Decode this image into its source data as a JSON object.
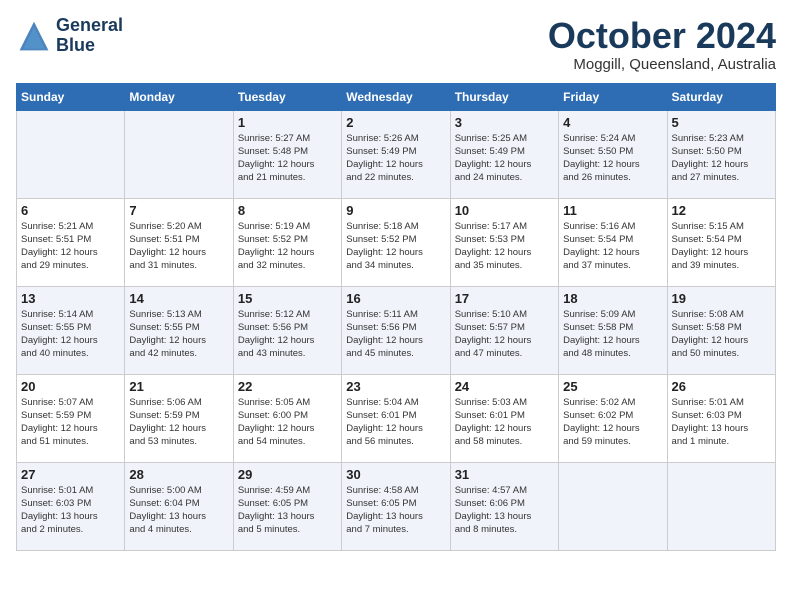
{
  "header": {
    "logo_line1": "General",
    "logo_line2": "Blue",
    "month": "October 2024",
    "location": "Moggill, Queensland, Australia"
  },
  "days_of_week": [
    "Sunday",
    "Monday",
    "Tuesday",
    "Wednesday",
    "Thursday",
    "Friday",
    "Saturday"
  ],
  "weeks": [
    [
      {
        "day": "",
        "info": ""
      },
      {
        "day": "",
        "info": ""
      },
      {
        "day": "1",
        "info": "Sunrise: 5:27 AM\nSunset: 5:48 PM\nDaylight: 12 hours\nand 21 minutes."
      },
      {
        "day": "2",
        "info": "Sunrise: 5:26 AM\nSunset: 5:49 PM\nDaylight: 12 hours\nand 22 minutes."
      },
      {
        "day": "3",
        "info": "Sunrise: 5:25 AM\nSunset: 5:49 PM\nDaylight: 12 hours\nand 24 minutes."
      },
      {
        "day": "4",
        "info": "Sunrise: 5:24 AM\nSunset: 5:50 PM\nDaylight: 12 hours\nand 26 minutes."
      },
      {
        "day": "5",
        "info": "Sunrise: 5:23 AM\nSunset: 5:50 PM\nDaylight: 12 hours\nand 27 minutes."
      }
    ],
    [
      {
        "day": "6",
        "info": "Sunrise: 5:21 AM\nSunset: 5:51 PM\nDaylight: 12 hours\nand 29 minutes."
      },
      {
        "day": "7",
        "info": "Sunrise: 5:20 AM\nSunset: 5:51 PM\nDaylight: 12 hours\nand 31 minutes."
      },
      {
        "day": "8",
        "info": "Sunrise: 5:19 AM\nSunset: 5:52 PM\nDaylight: 12 hours\nand 32 minutes."
      },
      {
        "day": "9",
        "info": "Sunrise: 5:18 AM\nSunset: 5:52 PM\nDaylight: 12 hours\nand 34 minutes."
      },
      {
        "day": "10",
        "info": "Sunrise: 5:17 AM\nSunset: 5:53 PM\nDaylight: 12 hours\nand 35 minutes."
      },
      {
        "day": "11",
        "info": "Sunrise: 5:16 AM\nSunset: 5:54 PM\nDaylight: 12 hours\nand 37 minutes."
      },
      {
        "day": "12",
        "info": "Sunrise: 5:15 AM\nSunset: 5:54 PM\nDaylight: 12 hours\nand 39 minutes."
      }
    ],
    [
      {
        "day": "13",
        "info": "Sunrise: 5:14 AM\nSunset: 5:55 PM\nDaylight: 12 hours\nand 40 minutes."
      },
      {
        "day": "14",
        "info": "Sunrise: 5:13 AM\nSunset: 5:55 PM\nDaylight: 12 hours\nand 42 minutes."
      },
      {
        "day": "15",
        "info": "Sunrise: 5:12 AM\nSunset: 5:56 PM\nDaylight: 12 hours\nand 43 minutes."
      },
      {
        "day": "16",
        "info": "Sunrise: 5:11 AM\nSunset: 5:56 PM\nDaylight: 12 hours\nand 45 minutes."
      },
      {
        "day": "17",
        "info": "Sunrise: 5:10 AM\nSunset: 5:57 PM\nDaylight: 12 hours\nand 47 minutes."
      },
      {
        "day": "18",
        "info": "Sunrise: 5:09 AM\nSunset: 5:58 PM\nDaylight: 12 hours\nand 48 minutes."
      },
      {
        "day": "19",
        "info": "Sunrise: 5:08 AM\nSunset: 5:58 PM\nDaylight: 12 hours\nand 50 minutes."
      }
    ],
    [
      {
        "day": "20",
        "info": "Sunrise: 5:07 AM\nSunset: 5:59 PM\nDaylight: 12 hours\nand 51 minutes."
      },
      {
        "day": "21",
        "info": "Sunrise: 5:06 AM\nSunset: 5:59 PM\nDaylight: 12 hours\nand 53 minutes."
      },
      {
        "day": "22",
        "info": "Sunrise: 5:05 AM\nSunset: 6:00 PM\nDaylight: 12 hours\nand 54 minutes."
      },
      {
        "day": "23",
        "info": "Sunrise: 5:04 AM\nSunset: 6:01 PM\nDaylight: 12 hours\nand 56 minutes."
      },
      {
        "day": "24",
        "info": "Sunrise: 5:03 AM\nSunset: 6:01 PM\nDaylight: 12 hours\nand 58 minutes."
      },
      {
        "day": "25",
        "info": "Sunrise: 5:02 AM\nSunset: 6:02 PM\nDaylight: 12 hours\nand 59 minutes."
      },
      {
        "day": "26",
        "info": "Sunrise: 5:01 AM\nSunset: 6:03 PM\nDaylight: 13 hours\nand 1 minute."
      }
    ],
    [
      {
        "day": "27",
        "info": "Sunrise: 5:01 AM\nSunset: 6:03 PM\nDaylight: 13 hours\nand 2 minutes."
      },
      {
        "day": "28",
        "info": "Sunrise: 5:00 AM\nSunset: 6:04 PM\nDaylight: 13 hours\nand 4 minutes."
      },
      {
        "day": "29",
        "info": "Sunrise: 4:59 AM\nSunset: 6:05 PM\nDaylight: 13 hours\nand 5 minutes."
      },
      {
        "day": "30",
        "info": "Sunrise: 4:58 AM\nSunset: 6:05 PM\nDaylight: 13 hours\nand 7 minutes."
      },
      {
        "day": "31",
        "info": "Sunrise: 4:57 AM\nSunset: 6:06 PM\nDaylight: 13 hours\nand 8 minutes."
      },
      {
        "day": "",
        "info": ""
      },
      {
        "day": "",
        "info": ""
      }
    ]
  ]
}
